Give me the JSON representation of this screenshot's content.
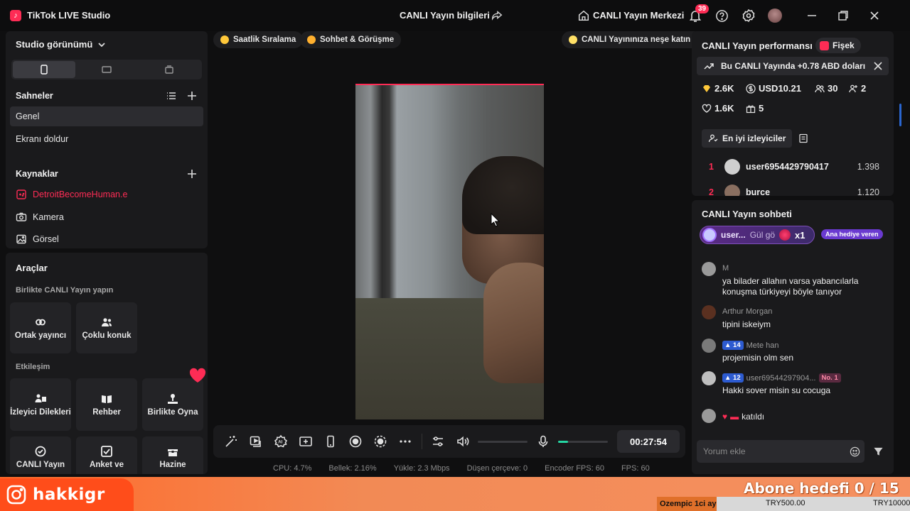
{
  "titlebar": {
    "app_name": "TikTok LIVE Studio",
    "center_title": "CANLI Yayın bilgileri",
    "hub_label": "CANLI Yayın Merkezi",
    "notification_count": "39"
  },
  "studio": {
    "view_label": "Studio görünümü",
    "scenes_title": "Sahneler",
    "scenes": [
      "Genel",
      "Ekranı doldur"
    ],
    "sources_title": "Kaynaklar",
    "sources": [
      {
        "label": "DetroitBecomeHuman.e",
        "icon": "gamepad-icon"
      },
      {
        "label": "Kamera",
        "icon": "camera-icon"
      },
      {
        "label": "Görsel",
        "icon": "image-icon"
      }
    ]
  },
  "tools": {
    "title": "Araçlar",
    "collab_title": "Birlikte CANLI Yayın yapın",
    "collab_tiles": [
      "Ortak yayıncı",
      "Çoklu konuk"
    ],
    "interaction_title": "Etkileşim",
    "interaction_tiles": [
      "İzleyici Dilekleri",
      "Rehber",
      "Birlikte Oyna"
    ],
    "more_tiles": [
      "CANLI Yayın",
      "Anket ve",
      "Hazine"
    ]
  },
  "top_pills": {
    "hourly": "Saatlik Sıralama",
    "chat": "Sohbet & Görüşme",
    "fun": "CANLI Yayınınıza neşe katın"
  },
  "controls": {
    "timer": "00:27:54",
    "mic_level": 0.2
  },
  "stats": {
    "cpu": "CPU:  4.7%",
    "memory": "Bellek:  2.16%",
    "upload": "Yükle:  2.3 Mbps",
    "dropped": "Düşen çerçeve:  0",
    "encoder": "Encoder FPS:  60",
    "fps": "FPS:  60"
  },
  "performance": {
    "title": "CANLI Yayın performansı",
    "fisek": "Fişek",
    "earnings": "Bu CANLI Yayında +0.78 ABD doları",
    "diamonds": "2.6K",
    "usd": "USD10.21",
    "viewers": "30",
    "new_followers": "2",
    "likes": "1.6K",
    "gifts": "5",
    "top_viewers_label": "En iyi izleyiciler",
    "top_viewers": [
      {
        "rank": "1",
        "name": "user6954429790417",
        "score": "1.398"
      },
      {
        "rank": "2",
        "name": "burce",
        "score": "1.120"
      }
    ]
  },
  "chat": {
    "title": "CANLI Yayın sohbeti",
    "gift_banner": {
      "user": "user...",
      "gift": "Gül gö",
      "count": "x1",
      "badge": "Ana hediye veren"
    },
    "messages": [
      {
        "user": "M",
        "text": "ya bilader allahın varsa yabancılarla konuşma türkiyeyi böyle tanıyor"
      },
      {
        "user": "Arthur Morgan",
        "text": "tipini iskeiym"
      },
      {
        "level": "14",
        "user": "Mete han",
        "text": "projemisin olm sen"
      },
      {
        "level": "12",
        "user": "user69544297904...",
        "badge": "No. 1",
        "text": "Hakki sover misin su cocuga"
      },
      {
        "text": "katıldı"
      }
    ],
    "comment_placeholder": "Yorum ekle"
  },
  "overlay": {
    "instagram_handle": "hakkigr",
    "sub_goal": "Abone hedefi 0 / 15",
    "ticker_label": "Ozempic 1ci ay",
    "ticker_value1": "TRY500.00",
    "ticker_value2": "TRY10000"
  },
  "colors": {
    "accent": "#fe2c55",
    "panel": "#1a1a1c",
    "background": "#0f0f10",
    "mic_green": "#25d6a3",
    "overlay_orange": "#ff6a2a"
  }
}
